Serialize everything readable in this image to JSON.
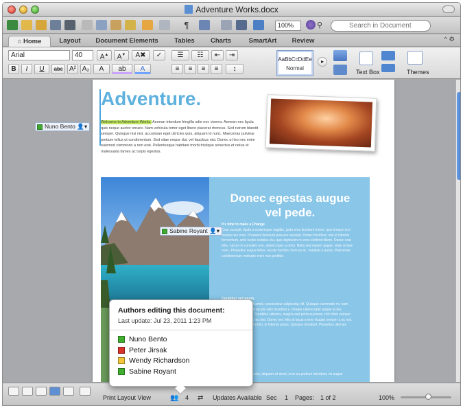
{
  "window": {
    "title": "Adventure Works.docx"
  },
  "toolbar": {
    "zoom_value": "100%",
    "search_placeholder": "Search in Document"
  },
  "ribbon_tabs": [
    "Home",
    "Layout",
    "Document Elements",
    "Tables",
    "Charts",
    "SmartArt",
    "Review"
  ],
  "ribbon_right": "^ ⚙",
  "ribbon": {
    "font_name": "Arial",
    "font_size": "40",
    "style_sample": "AaBbCcDdEe",
    "style_name": "Normal",
    "text_box_label": "Text Box",
    "themes_label": "Themes"
  },
  "document": {
    "heading": "Adventure.",
    "highlighted": "Welcome to Adventure Works.",
    "body": " Aenean interdum fringilla odio nec viverra. Aenean nec ligula quis neque auctor ornare. Nam vehicula tortor eget libero placerat rhoncus. Sed rutrum blandit semper. Quisque nisi nisl, accumsan eget ultricies quis, aliquam id nunc. Maecenas pulvinar pretium tellus ut condimentum. Sed vitae neque dui, vel faucibus nisi. Donec ut leo nec enim euismod commodo a non erat. Pellentesque habitant morbi tristique senectus et netus et malesuada fames ac turpis egestas.",
    "panel_title": "Donec egestas augue vel pede.",
    "panel_sub": "It's time to make a Change",
    "panel_body": "Cras suscipit, ligula a scelerisque sagittis, justo eros tincidunt lorem, quis tempor orci massa nec eros. Praesent tincidunt posuere suscipit. Donec tincidunt, nisl ut lobortis fermentum, ante turpis sodales dui, quis dignissim mi eros eleifend libero. Donec erat felis, rutrum in convallis non, ullamcorper a dolor. Nulla sed sapien augue, vitae ornare nunc. Phasellus augue tellus, iaculis facilisis rhoncus ac, volutpat a purus. Maecenas condimentum molestie enim non porttitor.",
    "panel_sub2": "Curabitur vel ipsum.",
    "panel_body2": "Lorem ipsum dolor sit amet, consectetur adipiscing elit. Quisque commodo mi, nam aliquet congue orci, at iaculis odio tincidunt a. Integer ullamcorper augue at dui. Suspendisse potenti. Curabitur ultricies, magna sed porta euismod, nisl dolor semper lacus, et mattis mi leo eu nisl. Donec nec felis at lacus a eros feugiat semper a ac nisl. Maecenas consequat enim, in lobortis purus. Quisque tincidunt. Phasellus ultricies placerat velit nec.",
    "panel_tail": "Morbi mollis, nisl quis dui, aliquam sit amet, eros eu pretium interdum, mi augue"
  },
  "author_tags": [
    {
      "name": "Nuno Bento",
      "color": "#41a834"
    },
    {
      "name": "Sabine Royant",
      "color": "#41a834"
    }
  ],
  "popup": {
    "title": "Authors editing this document:",
    "last_update": "Last update:   Jul 23, 2011 1:23 PM",
    "authors": [
      {
        "name": "Nuno Bento",
        "color": "#3fae2e"
      },
      {
        "name": "Peter Jirsak",
        "color": "#d9322b"
      },
      {
        "name": "Wendy Richardson",
        "color": "#f2c53a"
      },
      {
        "name": "Sabine Royant",
        "color": "#3fae2e"
      }
    ]
  },
  "status": {
    "view_name": "Print Layout View",
    "authors_count": "4",
    "updates": "Updates Available",
    "sec_label": "Sec",
    "sec_value": "1",
    "pages_label": "Pages:",
    "pages_value": "1 of 2",
    "zoom": "100%"
  }
}
